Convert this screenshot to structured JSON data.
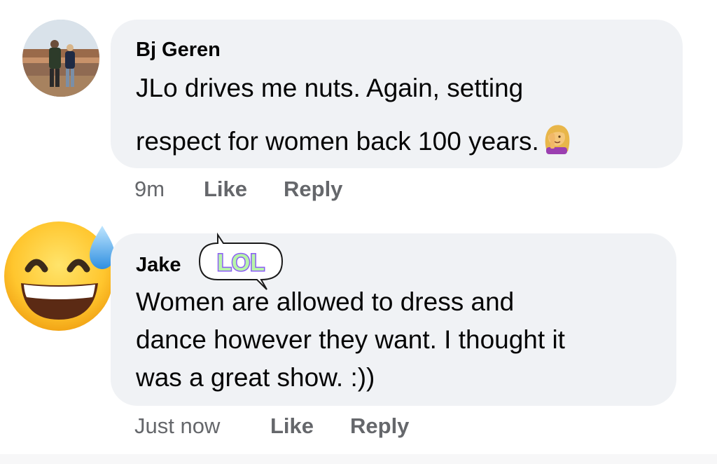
{
  "comments": [
    {
      "author": "Bj Geren",
      "avatar": "profile-photo",
      "lines": [
        "JLo drives me nuts. Again, setting",
        "respect for women back 100 years."
      ],
      "trailing_emoji": "woman-facepalming-icon",
      "time": "9m",
      "like_label": "Like",
      "reply_label": "Reply"
    },
    {
      "author": "Jake",
      "avatar": "grinning-face-with-sweat-icon",
      "sticker": "LOL",
      "lines": [
        "Women are allowed to dress and",
        "dance however they want. I thought it",
        "was a great show. :))"
      ],
      "time": "Just now",
      "like_label": "Like",
      "reply_label": "Reply"
    }
  ],
  "colors": {
    "bubble": "#f0f2f5",
    "meta_text": "#65676b",
    "sticker_purple": "#8b5cf6",
    "sticker_green": "#b7f5a8"
  }
}
